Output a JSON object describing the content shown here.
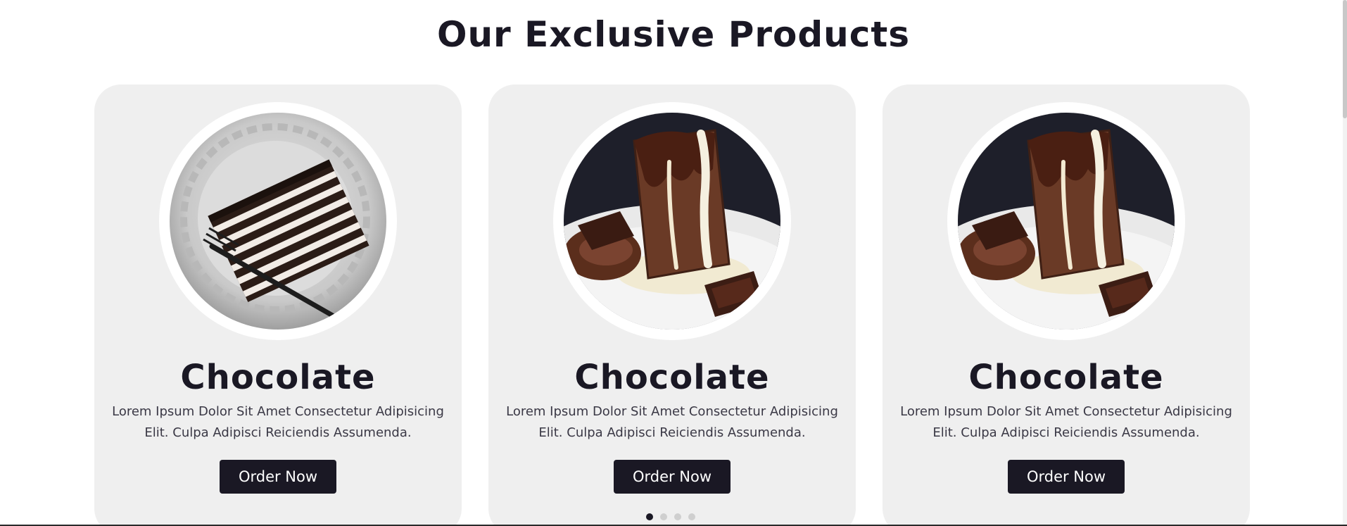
{
  "section": {
    "title": "Our Exclusive Products"
  },
  "products": [
    {
      "image_icon": "layered-chocolate-cake-slice-photo",
      "title": "Chocolate",
      "description": "Lorem Ipsum Dolor Sit Amet Consectetur Adipisicing Elit. Culpa Adipisci Reiciendis Assumenda.",
      "button_label": "Order Now"
    },
    {
      "image_icon": "molten-chocolate-lava-cake-photo",
      "title": "Chocolate",
      "description": "Lorem Ipsum Dolor Sit Amet Consectetur Adipisicing Elit. Culpa Adipisci Reiciendis Assumenda.",
      "button_label": "Order Now"
    },
    {
      "image_icon": "molten-chocolate-lava-cake-photo",
      "title": "Chocolate",
      "description": "Lorem Ipsum Dolor Sit Amet Consectetur Adipisicing Elit. Culpa Adipisci Reiciendis Assumenda.",
      "button_label": "Order Now"
    }
  ],
  "carousel": {
    "total_pages": 4,
    "active_page": 1
  },
  "colors": {
    "primary_dark": "#1a1824",
    "card_background": "#efefef",
    "dot_inactive": "#cfcfcf"
  }
}
